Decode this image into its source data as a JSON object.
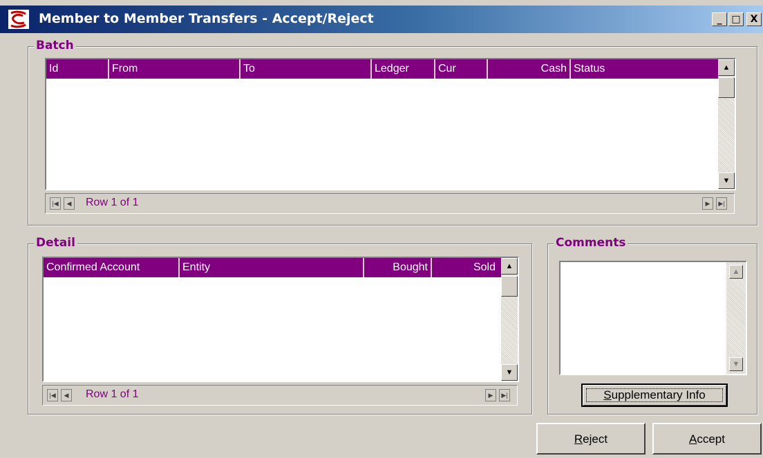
{
  "window": {
    "title": "Member to Member Transfers - Accept/Reject",
    "minimize": "_",
    "maximize": "□",
    "close": "X"
  },
  "batch": {
    "label": "Batch",
    "columns": [
      "Id",
      "From",
      "To",
      "Ledger",
      "Cur",
      "Cash",
      "Status"
    ],
    "rows": [],
    "nav_text": "Row 1 of 1"
  },
  "detail": {
    "label": "Detail",
    "columns": [
      "Confirmed Account",
      "Entity",
      "Bought",
      "Sold"
    ],
    "rows": [],
    "nav_text": "Row 1 of 1"
  },
  "comments": {
    "label": "Comments",
    "value": ""
  },
  "buttons": {
    "supplementary_prefix": "S",
    "supplementary_rest": "upplementary Info",
    "reject_prefix": "R",
    "reject_rest": "eject",
    "accept_prefix": "A",
    "accept_rest": "ccept"
  },
  "icons": {
    "app": "app-logo-icon",
    "scroll_up": "scroll-up-icon",
    "scroll_down": "scroll-down-icon",
    "nav_first": "nav-first-icon",
    "nav_prev": "nav-prev-icon",
    "nav_next": "nav-next-icon",
    "nav_last": "nav-last-icon"
  },
  "colors": {
    "header_bg": "#800080",
    "group_label": "#800080",
    "face": "#d4d0c8"
  }
}
